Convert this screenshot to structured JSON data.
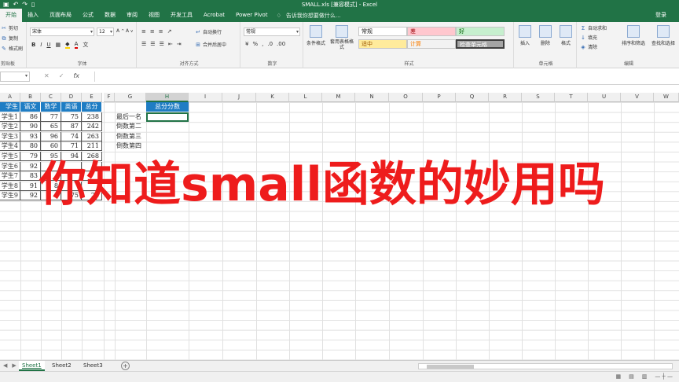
{
  "window": {
    "title": "SMALL.xls  [兼容模式] - Excel"
  },
  "tabs": [
    "开始",
    "插入",
    "页面布局",
    "公式",
    "数据",
    "审阅",
    "视图",
    "开发工具",
    "Acrobat",
    "Power Pivot"
  ],
  "tell_me": "告诉我你想要做什么...",
  "login": "登录",
  "ribbon": {
    "clipboard": {
      "cut": "剪切",
      "copy": "复制",
      "painter": "格式刷",
      "label": "剪贴板"
    },
    "font": {
      "name": "宋体",
      "size": "12",
      "label": "字体"
    },
    "alignment": {
      "wrap": "自动换行",
      "merge": "合并后居中",
      "label": "对齐方式"
    },
    "number": {
      "format": "常规",
      "label": "数字"
    },
    "styles": {
      "cond": "条件格式",
      "table": "套用表格格式",
      "cells": [
        {
          "text": "常规",
          "bg": "#ffffff",
          "color": "#222222"
        },
        {
          "text": "差",
          "bg": "#ffc7ce",
          "color": "#9c0006"
        },
        {
          "text": "好",
          "bg": "#c6efce",
          "color": "#006100"
        },
        {
          "text": "适中",
          "bg": "#ffeb9c",
          "color": "#9c5700"
        },
        {
          "text": "计算",
          "bg": "#f2f2f2",
          "color": "#fa7d00"
        },
        {
          "text": "检查单元格",
          "bg": "#a5a5a5",
          "color": "#ffffff"
        }
      ],
      "label": "样式"
    },
    "cells_grp": {
      "insert": "插入",
      "delete": "删除",
      "format": "格式",
      "label": "单元格"
    },
    "editing": {
      "autosum": "自动求和",
      "fill": "填充",
      "clear": "清除",
      "sort": "排序和筛选",
      "find": "查找和选择",
      "label": "编辑"
    }
  },
  "formula_bar": {
    "fx": "fx"
  },
  "columns": [
    "A",
    "B",
    "C",
    "D",
    "E",
    "F",
    "G",
    "H",
    "I",
    "J",
    "K",
    "L",
    "M",
    "N",
    "O",
    "P",
    "Q",
    "R",
    "S",
    "T",
    "U",
    "V",
    "W"
  ],
  "table": {
    "headers": [
      "学生",
      "语文",
      "数学",
      "英语",
      "总分"
    ],
    "rows": [
      [
        "学生1",
        "86",
        "77",
        "75",
        "238"
      ],
      [
        "学生2",
        "90",
        "65",
        "87",
        "242"
      ],
      [
        "学生3",
        "93",
        "96",
        "74",
        "263"
      ],
      [
        "学生4",
        "80",
        "60",
        "71",
        "211"
      ],
      [
        "学生5",
        "79",
        "95",
        "94",
        "268"
      ],
      [
        "学生6",
        "92",
        "",
        "",
        ""
      ],
      [
        "学生7",
        "83",
        "",
        "",
        ""
      ],
      [
        "学生8",
        "91",
        "8",
        "",
        ""
      ],
      [
        "学生9",
        "92",
        "",
        "75",
        "23"
      ]
    ]
  },
  "side_labels": [
    "最后一名",
    "倒数第二",
    "倒数第三",
    "倒数第四"
  ],
  "h_header": "总分分数",
  "overlay_text": "你知道small函数的妙用吗",
  "sheets": [
    "Sheet1",
    "Sheet2",
    "Sheet3"
  ]
}
